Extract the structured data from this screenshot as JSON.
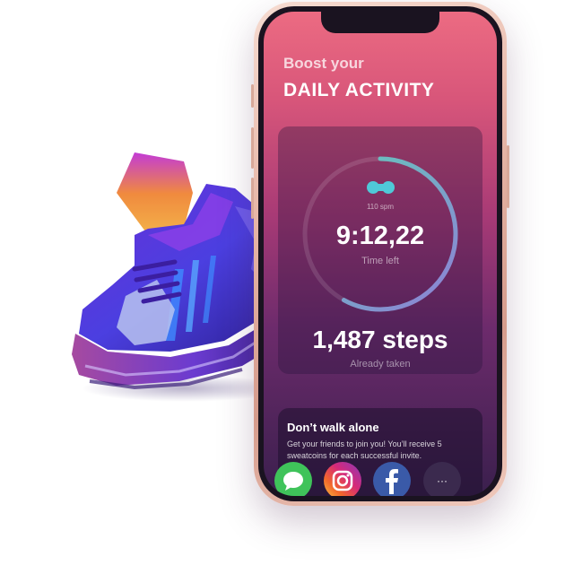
{
  "header": {
    "subtitle": "Boost your",
    "title": "DAILY ACTIVITY"
  },
  "activity": {
    "cadence": "110 spm",
    "timer": "9:12,22",
    "timer_label": "Time left",
    "steps": "1,487 steps",
    "steps_label": "Already taken",
    "ring_progress": 0.58,
    "ring_colors": [
      "#5fd0b8",
      "#8f7fd6"
    ]
  },
  "invite": {
    "title": "Don’t walk alone",
    "text": "Get your friends to join you! You’ll receive 5 sweatcoins for each successful invite."
  },
  "share": {
    "buttons": [
      {
        "name": "messages",
        "icon": "message-bubble-icon",
        "color": "#3fc35a"
      },
      {
        "name": "instagram",
        "icon": "instagram-icon",
        "color": "#d62979"
      },
      {
        "name": "facebook",
        "icon": "facebook-icon",
        "color": "#3a5aa8"
      },
      {
        "name": "more",
        "icon": "more-icon",
        "label": "···"
      }
    ]
  }
}
